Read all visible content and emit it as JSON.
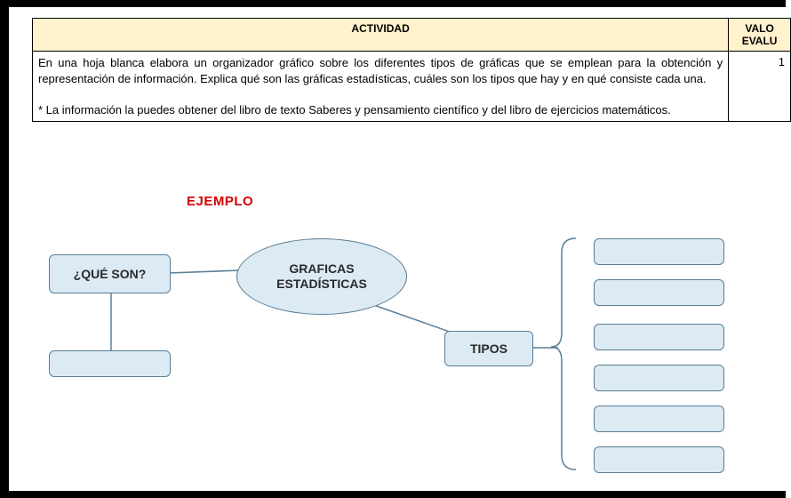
{
  "table": {
    "header_activity": "ACTIVIDAD",
    "header_value_line1": "VALO",
    "header_value_line2": "EVALU",
    "body_p1": "En una hoja blanca elabora un organizador gráfico sobre los diferentes tipos  de gráficas que se emplean para la obtención y representación de información. Explica qué son las gráficas estadísticas, cuáles son los tipos que hay y en qué consiste cada una.",
    "body_p2": "* La información la puedes obtener del libro de texto Saberes y pensamiento científico y del libro de ejercicios matemáticos.",
    "value": "1"
  },
  "example_label": "EJEMPLO",
  "diagram": {
    "que_son": "¿QUÉ SON?",
    "center_line1": "GRAFICAS",
    "center_line2": "ESTADÍSTICAS",
    "tipos": "TIPOS"
  }
}
